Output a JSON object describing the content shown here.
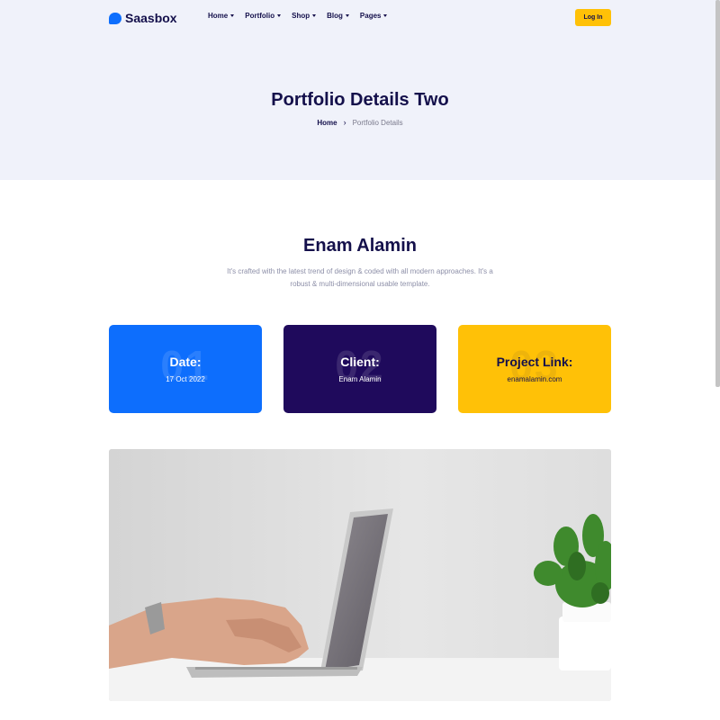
{
  "header": {
    "logo_text": "Saasbox",
    "nav": [
      {
        "label": "Home"
      },
      {
        "label": "Portfolio"
      },
      {
        "label": "Shop"
      },
      {
        "label": "Blog"
      },
      {
        "label": "Pages"
      }
    ],
    "login_label": "Log In"
  },
  "hero": {
    "title": "Portfolio Details Two",
    "breadcrumb_home": "Home",
    "breadcrumb_separator": "›",
    "breadcrumb_current": "Portfolio Details"
  },
  "intro": {
    "name": "Enam Alamin",
    "description": "It's crafted with the latest trend of design & coded with all modern approaches. It's a robust & multi-dimensional usable template."
  },
  "cards": [
    {
      "number": "01",
      "label": "Date:",
      "value": "17 Oct 2022",
      "color": "#0d6efd"
    },
    {
      "number": "02",
      "label": "Client:",
      "value": "Enam Alamin",
      "color": "#1f0a5c"
    },
    {
      "number": "03",
      "label": "Project Link:",
      "value": "enamalamin.com",
      "color": "#ffc107"
    }
  ],
  "colors": {
    "primary": "#0d6efd",
    "accent": "#ffc107",
    "dark": "#14104b",
    "hero_bg": "#f0f2fa"
  }
}
